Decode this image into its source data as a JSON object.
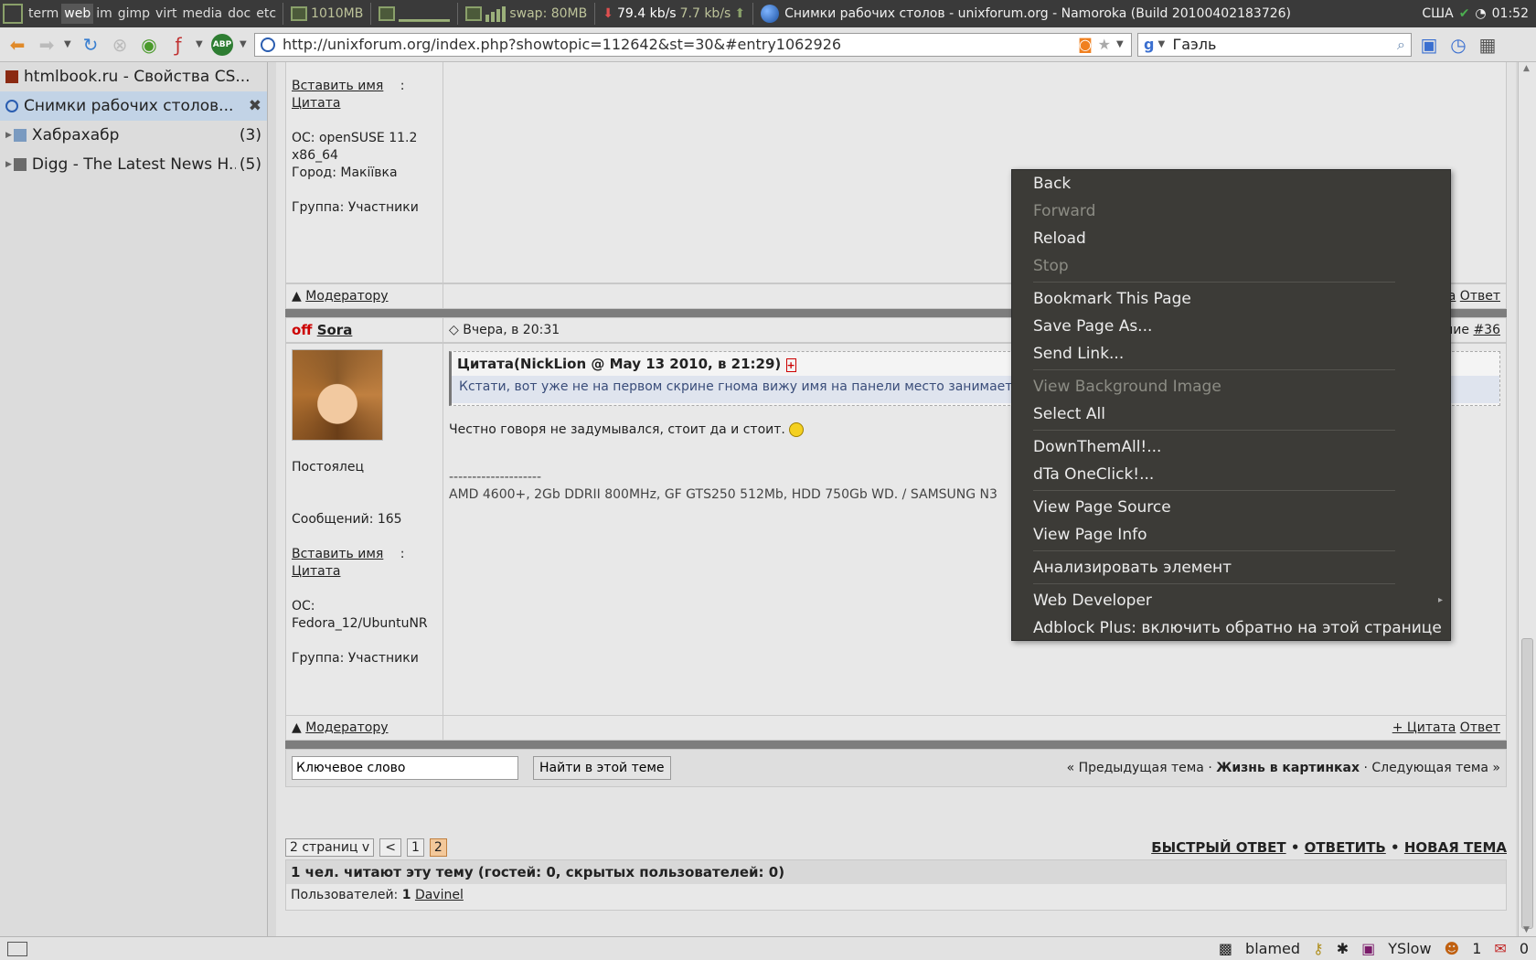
{
  "topbar": {
    "workspaces": [
      "term",
      "web",
      "im",
      "gimp",
      "virt",
      "media",
      "doc",
      "etc"
    ],
    "active_workspace": "web",
    "mem": "1010MB",
    "swap": "swap: 80MB",
    "down": "79.4 kb/s",
    "up": "7.7 kb/s",
    "window_title": "Снимки рабочих столов - unixforum.org - Namoroka (Build 20100402183726)",
    "layout": "США",
    "clock": "01:52"
  },
  "navbar": {
    "url": "http://unixforum.org/index.php?showtopic=112642&st=30&#entry1062926",
    "search": "Гаэль",
    "abp": "ABP"
  },
  "sidebar": {
    "items": [
      {
        "label": "htmlbook.ru - Свойства CS...",
        "count": ""
      },
      {
        "label": "Снимки рабочих столов...",
        "count": ""
      },
      {
        "label": "Хабрахабр",
        "count": "(3)"
      },
      {
        "label": "Digg - The Latest News H...",
        "count": "(5)"
      }
    ]
  },
  "post1": {
    "insert_name": "Вставить имя",
    "colon": ":",
    "quote": "Цитата",
    "os": "ОС: openSUSE 11.2 x86_64",
    "city": "Город: Макіївка",
    "group": "Группа: Участники",
    "moderator": "Модератору",
    "reply": "Ответ",
    "quote_right": "та"
  },
  "post2": {
    "status": "off",
    "author": "Sora",
    "date": "Вчера, в 20:31",
    "entry_link": "#36",
    "entry_prefix": "ние",
    "rank": "Постоялец",
    "messages": "Сообщений: 165",
    "insert_name": "Вставить имя",
    "colon": ":",
    "quote": "Цитата",
    "os_label": "ОС:",
    "os": "Fedora_12/UbuntuNR",
    "group": "Группа: Участники",
    "quote_header": "Цитата(NickLion @ May 13 2010, в 21:29)",
    "quote_body": "Кстати, вот уже не на первом скрине гнома вижу имя на панели место занимает - эт",
    "text": "Честно говоря не задумывался, стоит да и стоит.",
    "signature_sep": "--------------------",
    "signature": "AMD 4600+, 2Gb DDRII 800MHz, GF GTS250 512Mb, HDD 750Gb WD. / SAMSUNG N3",
    "moderator": "Модератору",
    "quote_action": "+ Цитата",
    "reply": "Ответ"
  },
  "search_row": {
    "input": "Ключевое слово",
    "button": "Найти в этой теме",
    "prev": "« Предыдущая тема",
    "dot": "·",
    "forum": "Жизнь в картинках",
    "next": "Следующая тема »"
  },
  "pager": {
    "pages": "2 страниц v",
    "prev": "<",
    "p1": "1",
    "p2": "2",
    "quick_reply": "БЫСТРЫЙ ОТВЕТ",
    "reply": "ОТВЕТИТЬ",
    "new_topic": "НОВАЯ ТЕМА",
    "bullet": "•"
  },
  "readers": {
    "title": "1 чел. читают эту тему (гостей: 0, скрытых пользователей: 0)",
    "users_label": "Пользователей:",
    "users_count": "1",
    "user": "Davinel"
  },
  "context_menu": {
    "items": [
      {
        "label": "Back",
        "disabled": false
      },
      {
        "label": "Forward",
        "disabled": true
      },
      {
        "label": "Reload",
        "disabled": false
      },
      {
        "label": "Stop",
        "disabled": true
      },
      {
        "sep": true
      },
      {
        "label": "Bookmark This Page",
        "disabled": false
      },
      {
        "label": "Save Page As...",
        "disabled": false
      },
      {
        "label": "Send Link...",
        "disabled": false
      },
      {
        "sep": true
      },
      {
        "label": "View Background Image",
        "disabled": true
      },
      {
        "label": "Select All",
        "disabled": false
      },
      {
        "sep": true
      },
      {
        "label": "DownThemAll!...",
        "disabled": false
      },
      {
        "label": "dTa OneClick!...",
        "disabled": false
      },
      {
        "sep": true
      },
      {
        "label": "View Page Source",
        "disabled": false
      },
      {
        "label": "View Page Info",
        "disabled": false
      },
      {
        "sep": true
      },
      {
        "label": "Анализировать элемент",
        "disabled": false
      },
      {
        "sep": true
      },
      {
        "label": "Web Developer",
        "disabled": false,
        "submenu": true
      },
      {
        "label": "Adblock Plus: включить обратно на этой странице",
        "disabled": false
      }
    ]
  },
  "statusbar": {
    "blamed": "blamed",
    "yslow": "YSlow",
    "n1": "1",
    "n2": "0"
  },
  "colors": {
    "menu_bg": "#3c3b37",
    "offline": "#cc0000",
    "active_tab": "#c2d3e6"
  }
}
